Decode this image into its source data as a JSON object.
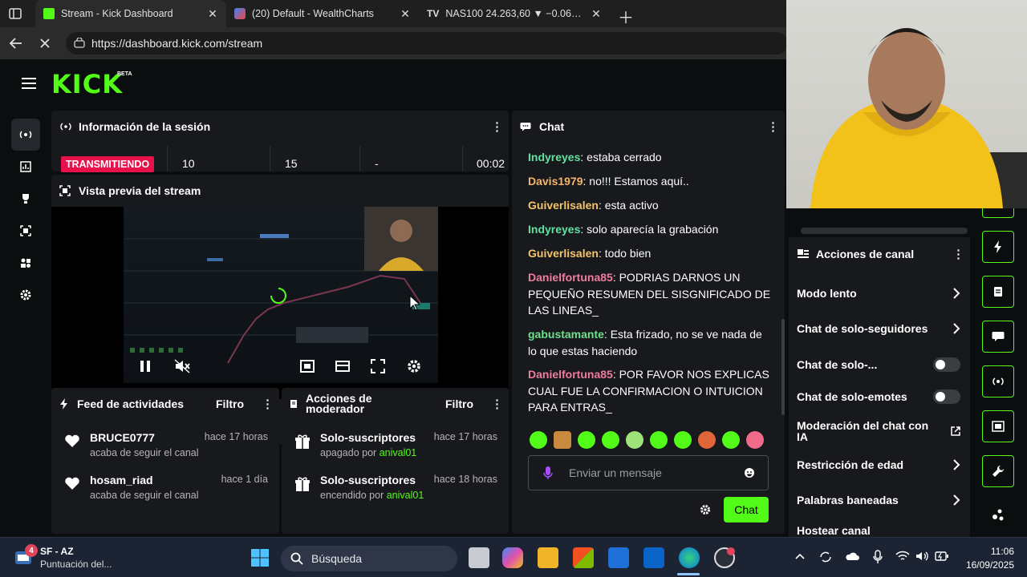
{
  "browser": {
    "tabs": [
      {
        "title": "Stream - Kick Dashboard",
        "active": true
      },
      {
        "title": "(20) Default - WealthCharts",
        "active": false
      },
      {
        "title": "NAS100 24.263,60 ▼ −0.06% Unn...",
        "active": false
      }
    ],
    "url": "https://dashboard.kick.com/stream"
  },
  "kick": {
    "logo": "KICK",
    "logo_badge": "BETA",
    "accent": "#53fc18"
  },
  "session": {
    "title": "Información de la sesión",
    "status": "TRANSMITIENDO",
    "stats": [
      "10",
      "15",
      "-",
      "00:02"
    ]
  },
  "preview": {
    "title": "Vista previa del stream"
  },
  "activity": {
    "title": "Feed de actividades",
    "filter": "Filtro",
    "items": [
      {
        "name": "BRUCE0777",
        "time": "hace 17 horas",
        "desc": "acaba de seguir el canal"
      },
      {
        "name": "hosam_riad",
        "time": "hace 1 día",
        "desc": "acaba de seguir el canal"
      }
    ]
  },
  "modactions": {
    "title_line1": "Acciones de",
    "title_line2": "moderador",
    "filter": "Filtro",
    "items": [
      {
        "name": "Solo-suscriptores",
        "time": "hace 17 horas",
        "desc": "apagado por",
        "by": "anival01"
      },
      {
        "name": "Solo-suscriptores",
        "time": "hace 18 horas",
        "desc": "encendido por",
        "by": "anival01"
      }
    ]
  },
  "chat": {
    "title": "Chat",
    "messages": [
      {
        "user": "Indyreyes",
        "color": "#5ee3a1",
        "text": "estaba cerrado"
      },
      {
        "user": "Davis1979",
        "color": "#f5b56b",
        "text": "no!!! Estamos aquí.."
      },
      {
        "user": "Guiverlisalen",
        "color": "#f5c46b",
        "text": "esta activo"
      },
      {
        "user": "Indyreyes",
        "color": "#5ee3a1",
        "text": "solo aparecía la grabación"
      },
      {
        "user": "Guiverlisalen",
        "color": "#f5c46b",
        "text": "todo bien"
      },
      {
        "user": "Danielfortuna85",
        "color": "#f07ca0",
        "text": "PODRIAS DARNOS UN PEQUEÑO RESUMEN DEL SISGNIFICADO DE LAS LINEAS_"
      },
      {
        "user": "gabustamante",
        "color": "#6de08c",
        "text": "Esta frizado, no se ve nada de lo que estas haciendo"
      },
      {
        "user": "Danielfortuna85",
        "color": "#f07ca0",
        "text": "POR FAVOR NOS EXPLICAS CUAL FUE LA CONFIRMACION O INTUICION PARA ENTRAS_"
      }
    ],
    "input_placeholder": "Enviar un mensaje",
    "send_label": "Chat"
  },
  "channel_actions": {
    "title": "Acciones de canal",
    "items": [
      {
        "label": "Modo lento",
        "kind": "chevron"
      },
      {
        "label": "Chat de solo-seguidores",
        "kind": "chevron"
      },
      {
        "label": "Chat de solo-...",
        "kind": "toggle"
      },
      {
        "label": "Chat de solo-emotes",
        "kind": "toggle"
      },
      {
        "label": "Moderación del chat con IA",
        "kind": "external"
      },
      {
        "label": "Restricción de edad",
        "kind": "chevron"
      },
      {
        "label": "Palabras baneadas",
        "kind": "chevron"
      },
      {
        "label": "Hostear canal",
        "kind": "chevron"
      }
    ]
  },
  "taskbar": {
    "weather_title": "SF - AZ",
    "weather_sub": "Puntuación del...",
    "notif_count": "4",
    "search_placeholder": "Búsqueda",
    "time": "11:06",
    "date": "16/09/2025"
  }
}
